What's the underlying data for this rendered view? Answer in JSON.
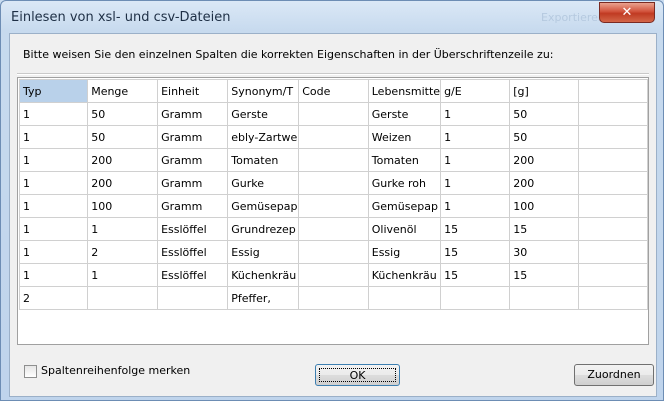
{
  "window": {
    "title": "Einlesen von xsl- und csv-Dateien",
    "ghost_title": "Exportieren",
    "close_glyph": "✕"
  },
  "instruction": "Bitte weisen Sie den einzelnen Spalten die korrekten Eigenschaften in der Überschriftenzeile zu:",
  "table": {
    "headers": [
      "Typ",
      "Menge",
      "Einheit",
      "Synonym/T",
      "Code",
      "Lebensmitte",
      "g/E",
      "[g]",
      ""
    ],
    "rows": [
      [
        "1",
        "50",
        "Gramm",
        "Gerste",
        "",
        "Gerste",
        "1",
        "50",
        ""
      ],
      [
        "1",
        "50",
        "Gramm",
        "ebly-Zartwe",
        "",
        "Weizen",
        "1",
        "50",
        ""
      ],
      [
        "1",
        "200",
        "Gramm",
        "Tomaten",
        "",
        "Tomaten",
        "1",
        "200",
        ""
      ],
      [
        "1",
        "200",
        "Gramm",
        "Gurke",
        "",
        "Gurke roh",
        "1",
        "200",
        ""
      ],
      [
        "1",
        "100",
        "Gramm",
        "Gemüsepap",
        "",
        "Gemüsepap",
        "1",
        "100",
        ""
      ],
      [
        "1",
        "1",
        "Esslöffel",
        "Grundrezep",
        "",
        "Olivenöl",
        "15",
        "15",
        ""
      ],
      [
        "1",
        "2",
        "Esslöffel",
        "Essig",
        "",
        "Essig",
        "15",
        "30",
        ""
      ],
      [
        "1",
        "1",
        "Esslöffel",
        "Küchenkräu",
        "",
        "Küchenkräu",
        "15",
        "15",
        ""
      ],
      [
        "2",
        "",
        "",
        "Pfeffer,",
        "",
        "",
        "",
        "",
        ""
      ]
    ]
  },
  "checkbox": {
    "label": "Spaltenreihenfolge merken",
    "checked": false
  },
  "buttons": {
    "ok": "OK",
    "assign": "Zuordnen"
  }
}
